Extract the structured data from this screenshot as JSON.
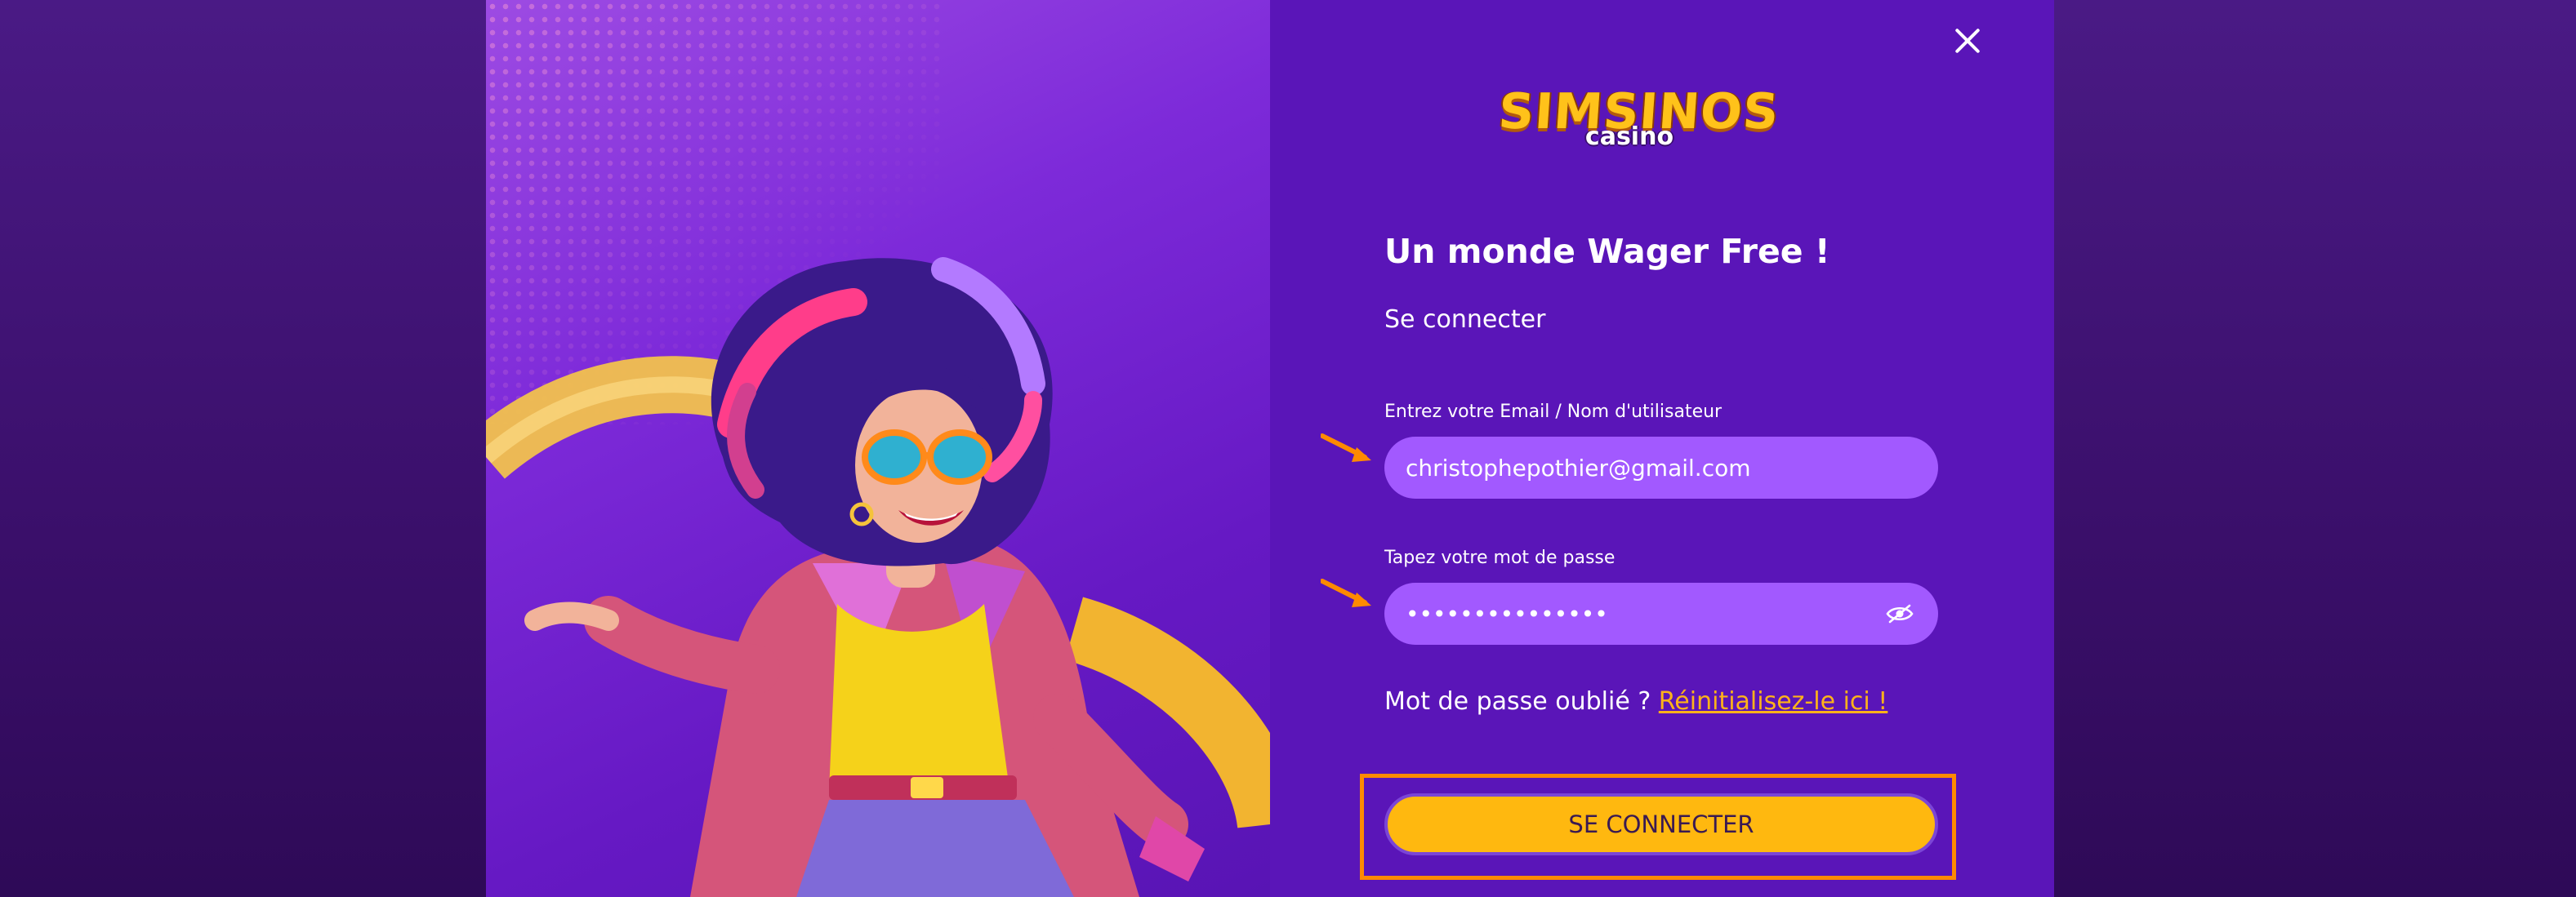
{
  "modal": {
    "close_label": "×",
    "logo": {
      "brand": "SIMSINOS",
      "sub": "casino"
    },
    "headline": "Un monde Wager Free !",
    "subhead": "Se connecter",
    "email": {
      "label": "Entrez votre Email / Nom d'utilisateur",
      "value": "christophepothier@gmail.com"
    },
    "password": {
      "label": "Tapez votre mot de passe",
      "value": "•••••••••••••••"
    },
    "forgot": {
      "text": "Mot de passe oublié ?",
      "link": "Réinitialisez-le ici !"
    },
    "submit_label": "SE CONNECTER"
  },
  "colors": {
    "panel": "#5a15b8",
    "input": "#a259ff",
    "accent": "#ffb80f",
    "highlight": "#ff8a00"
  },
  "icons": {
    "close": "close-icon",
    "eye": "eye-off-icon",
    "arrow": "arrow-icon"
  }
}
